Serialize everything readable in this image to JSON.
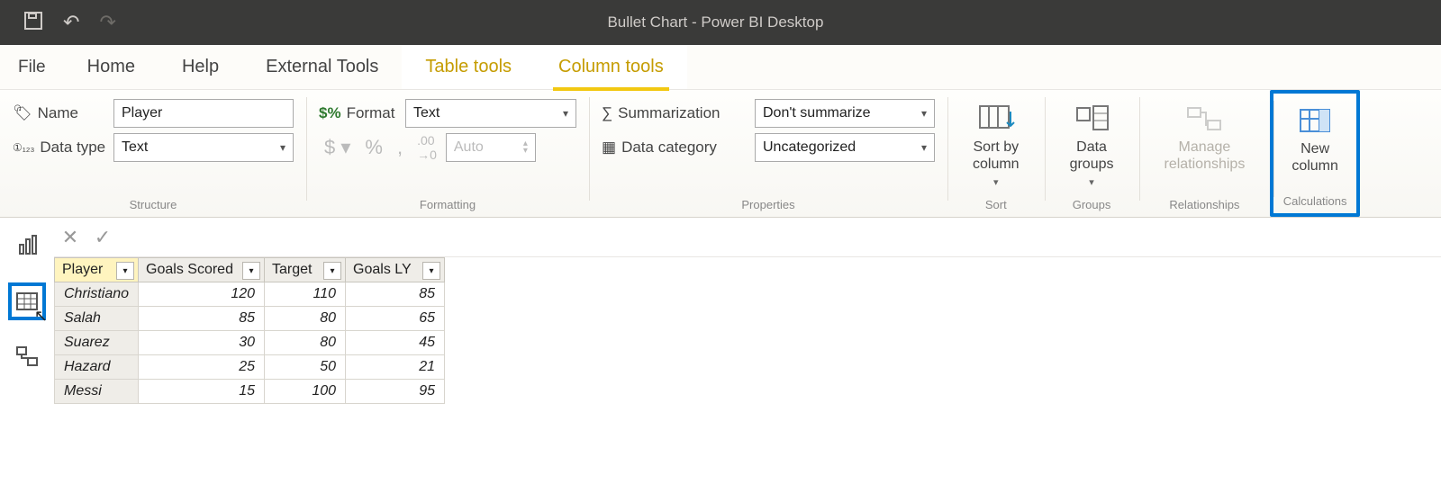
{
  "titlebar": {
    "title": "Bullet Chart - Power BI Desktop"
  },
  "tabs": {
    "file": "File",
    "list": [
      "Home",
      "Help",
      "External Tools",
      "Table tools",
      "Column tools"
    ],
    "active": "Column tools"
  },
  "ribbon": {
    "structure": {
      "name_label": "Name",
      "name_value": "Player",
      "datatype_label": "Data type",
      "datatype_value": "Text",
      "group": "Structure"
    },
    "formatting": {
      "format_label": "Format",
      "format_value": "Text",
      "auto_placeholder": "Auto",
      "group": "Formatting"
    },
    "properties": {
      "sum_label": "Summarization",
      "sum_value": "Don't summarize",
      "cat_label": "Data category",
      "cat_value": "Uncategorized",
      "group": "Properties"
    },
    "sort": {
      "label": "Sort by\ncolumn",
      "group": "Sort"
    },
    "groups": {
      "label": "Data\ngroups",
      "group": "Groups"
    },
    "relationships": {
      "label": "Manage\nrelationships",
      "group": "Relationships"
    },
    "calculations": {
      "label": "New\ncolumn",
      "group": "Calculations"
    }
  },
  "formula": {
    "value": ""
  },
  "grid": {
    "columns": [
      "Player",
      "Goals Scored",
      "Target",
      "Goals LY"
    ],
    "selected_col": "Player",
    "rows": [
      {
        "Player": "Christiano",
        "Goals Scored": 120,
        "Target": 110,
        "Goals LY": 85
      },
      {
        "Player": "Salah",
        "Goals Scored": 85,
        "Target": 80,
        "Goals LY": 65
      },
      {
        "Player": "Suarez",
        "Goals Scored": 30,
        "Target": 80,
        "Goals LY": 45
      },
      {
        "Player": "Hazard",
        "Goals Scored": 25,
        "Target": 50,
        "Goals LY": 21
      },
      {
        "Player": "Messi",
        "Goals Scored": 15,
        "Target": 100,
        "Goals LY": 95
      }
    ]
  }
}
